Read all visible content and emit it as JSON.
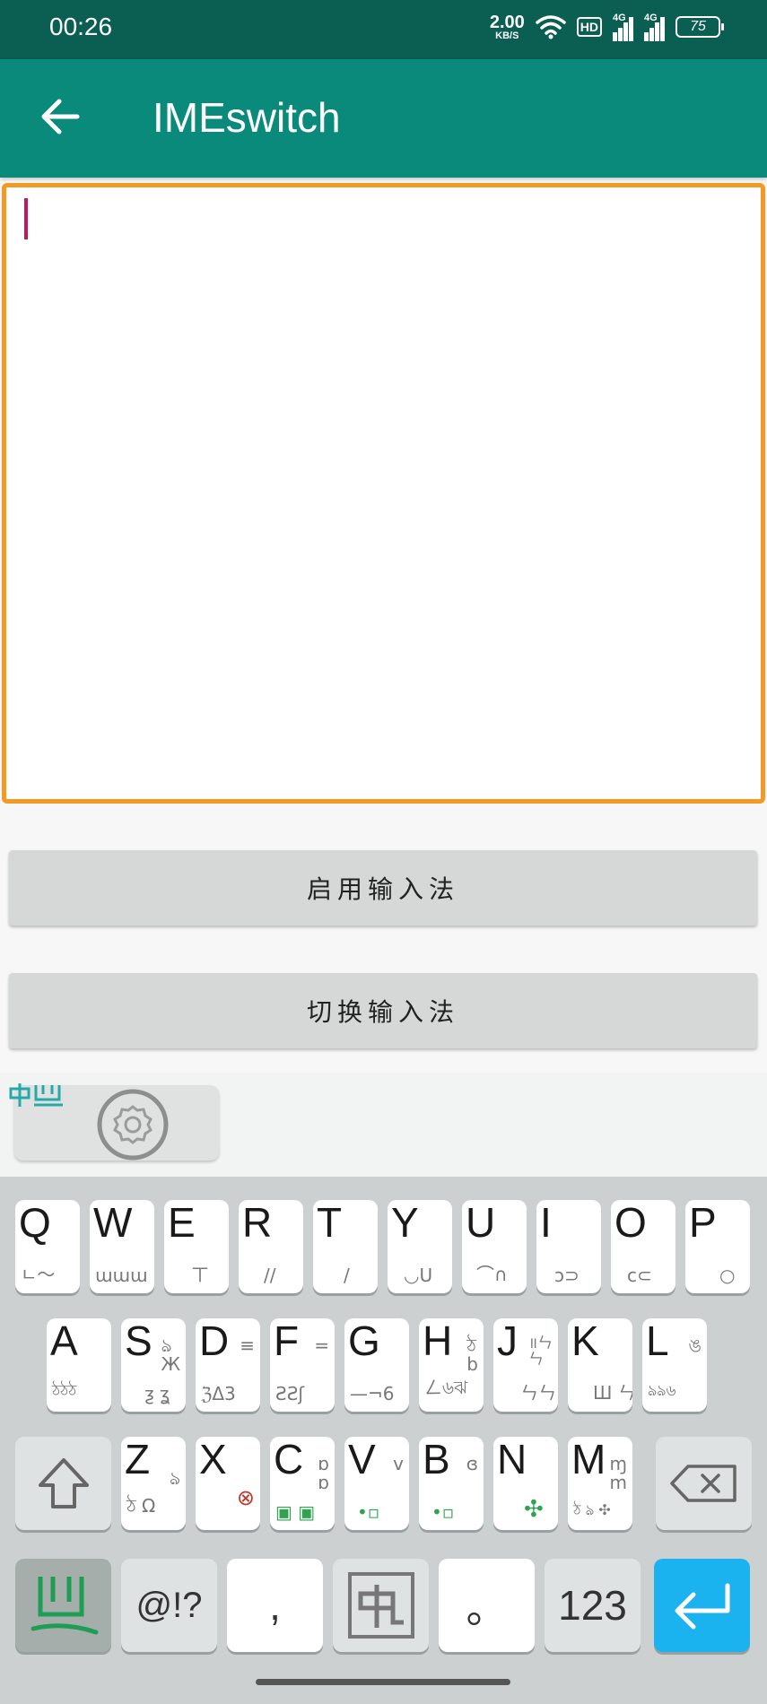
{
  "status": {
    "time": "00:26",
    "net_speed": "2.00",
    "net_unit": "KB/S",
    "hd": "HD",
    "sig1": "4G",
    "sig2": "4G",
    "battery": "75"
  },
  "appbar": {
    "title": "IMEswitch"
  },
  "buttons": {
    "enable_label": "启用输入法",
    "switch_label": "切换输入法"
  },
  "keyboard": {
    "row1": [
      {
        "main": "Q",
        "sub": "ㄴ～"
      },
      {
        "main": "W",
        "sub": "ɯɯɯ"
      },
      {
        "main": "E",
        "sub": "ㄒ"
      },
      {
        "main": "R",
        "sub": "//"
      },
      {
        "main": "T",
        "sub": "/"
      },
      {
        "main": "Y",
        "sub": "◡U"
      },
      {
        "main": "U",
        "sub": "⌒∩"
      },
      {
        "main": "I",
        "sub": "ɔ⊃"
      },
      {
        "main": "O",
        "sub": "c⊂"
      },
      {
        "main": "P",
        "sub": "○"
      }
    ],
    "row2": [
      {
        "main": "A",
        "sub": "ঠঠঠ",
        "side": ""
      },
      {
        "main": "S",
        "sub": "ƺ ʓ",
        "side": "ঌ\nЖ"
      },
      {
        "main": "D",
        "sub": "ℨΔ3",
        "side": "≡"
      },
      {
        "main": "F",
        "sub": "ƧƧʃ",
        "side": "="
      },
      {
        "main": "G",
        "sub": "—¬6",
        "side": ""
      },
      {
        "main": "H",
        "sub": "ㄥ৬ঝ",
        "side": "ঠ\nb"
      },
      {
        "main": "J",
        "sub": "ㄣㄣ",
        "side": "॥ㄣ\nㄣ"
      },
      {
        "main": "K",
        "sub": "Ш ㄣ",
        "side": ""
      },
      {
        "main": "L",
        "sub": "ঌঌ৬",
        "side": "ঙ"
      }
    ],
    "row3": [
      {
        "main": "Z",
        "sub": "ঠ Ω",
        "side": "ঌ"
      },
      {
        "main": "X",
        "sub": "",
        "side": "⊗"
      },
      {
        "main": "C",
        "sub": "▣ ▣",
        "side": "ɒ\nɒ"
      },
      {
        "main": "V",
        "sub": "•▫",
        "side": "v"
      },
      {
        "main": "B",
        "sub": "•▫",
        "side": "ɞ"
      },
      {
        "main": "N",
        "sub": "✣",
        "side": ""
      },
      {
        "main": "M",
        "sub": "ঠ ঌ ✣",
        "side": "ɱ\nm"
      }
    ],
    "symbols_key": "@!?",
    "comma_key": ",",
    "period_key": "。",
    "numbers_key": "123"
  },
  "colors": {
    "statusbar": "#0b5e52",
    "appbar": "#0a8a7b",
    "editor_border": "#f39a25",
    "cursor": "#c2185b",
    "enter_key": "#1ab2ef",
    "logo_green": "#1f9d55",
    "logo_teal": "#28a9a9"
  },
  "icons": {
    "back": "back-arrow-icon",
    "settings": "gear-icon",
    "shift": "shift-icon",
    "backspace": "backspace-icon",
    "enter": "enter-icon",
    "ime_logo": "ime-logo-icon",
    "chinese_toggle": "chinese-toggle-icon"
  }
}
